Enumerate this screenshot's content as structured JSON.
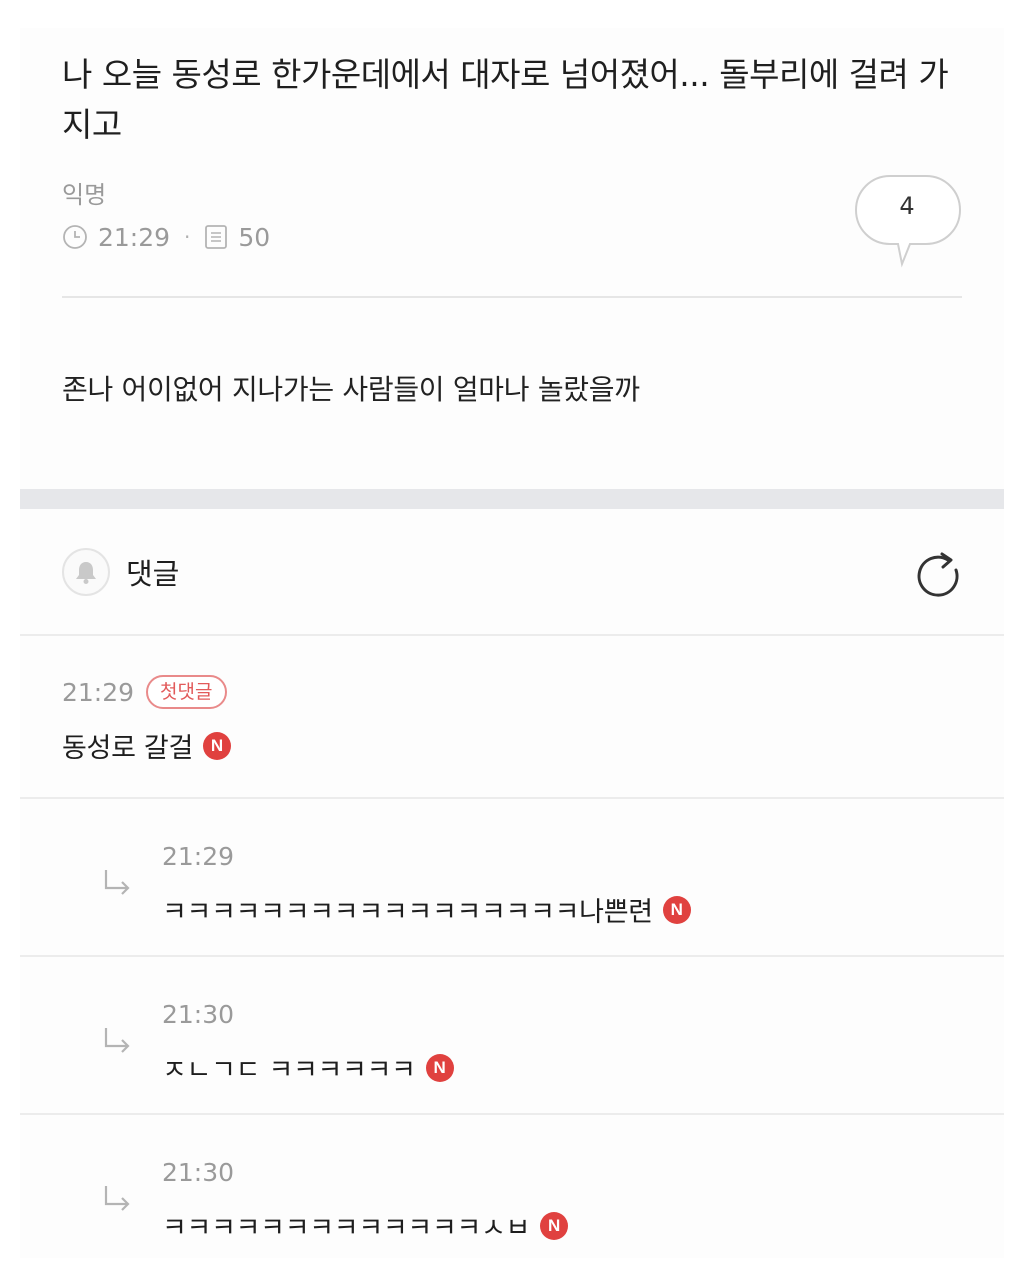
{
  "post": {
    "title": "나 오늘 동성로 한가운데에서 대자로 넘어졌어... 돌부리에 걸려 가지고",
    "author": "익명",
    "time": "21:29",
    "views": "50",
    "comment_count": "4",
    "body": "존나 어이없어 지나가는 사람들이 얼마나 놀랐을까"
  },
  "comments_section": {
    "label": "댓글"
  },
  "comments": [
    {
      "time": "21:29",
      "badge": "첫댓글",
      "text": "동성로 갈걸",
      "new": "N"
    }
  ],
  "replies": [
    {
      "time": "21:29",
      "text": "ㅋㅋㅋㅋㅋㅋㅋㅋㅋㅋㅋㅋㅋㅋㅋㅋㅋ나쁜련",
      "new": "N"
    },
    {
      "time": "21:30",
      "text": "ㅈㄴㄱㄷ ㅋㅋㅋㅋㅋㅋ",
      "new": "N"
    },
    {
      "time": "21:30",
      "text": "ㅋㅋㅋㅋㅋㅋㅋㅋㅋㅋㅋㅋㅋㅅㅂ",
      "new": "N"
    }
  ],
  "colors": {
    "new_badge": "#e0413f",
    "first_badge": "#e25a5a",
    "meta_text": "#9a9a9a"
  },
  "icons": {
    "clock": "clock-icon",
    "views": "document-icon",
    "comment_bubble": "speech-bubble-icon",
    "bell": "bell-icon",
    "refresh": "refresh-icon",
    "reply": "reply-arrow-icon"
  }
}
